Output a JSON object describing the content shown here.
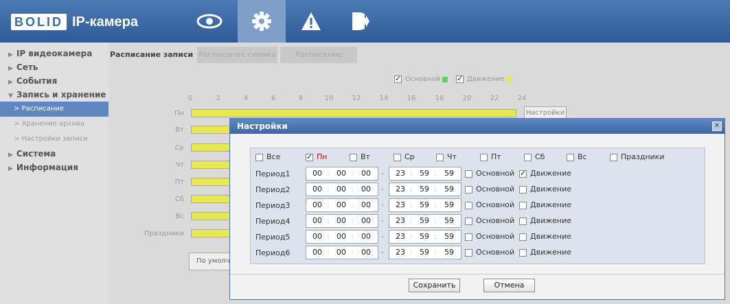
{
  "header": {
    "logo": "BOLID",
    "title": "IP-камера",
    "nav": [
      "eye-icon",
      "gear-icon",
      "alert-icon",
      "exit-icon"
    ]
  },
  "sidebar": {
    "items": [
      {
        "label": "IP видеокамера",
        "arrow": "▶"
      },
      {
        "label": "Сеть",
        "arrow": "▶"
      },
      {
        "label": "События",
        "arrow": "▶"
      },
      {
        "label": "Запись и хранение",
        "arrow": "▼"
      }
    ],
    "subitems": [
      "Расписание",
      "Хранение архива",
      "Настройки записи"
    ],
    "items2": [
      {
        "label": "Система",
        "arrow": "▶"
      },
      {
        "label": "Информация",
        "arrow": "▶"
      }
    ]
  },
  "tabs": [
    "Расписание записи",
    "Расписание снимка",
    "Расписание"
  ],
  "legend": {
    "main": "Основной",
    "motion": "Движение",
    "main_color": "#5fd35f",
    "motion_color": "#e8e84a"
  },
  "hours": [
    "0",
    "2",
    "4",
    "6",
    "8",
    "10",
    "12",
    "14",
    "16",
    "18",
    "20",
    "22",
    "24"
  ],
  "days": [
    "Пн",
    "Вт",
    "Ср",
    "Чт",
    "Пт",
    "Сб",
    "Вс",
    "Праздники"
  ],
  "settings_button": "Настройки",
  "default_button": "По умолч",
  "dialog": {
    "title": "Настройки",
    "close": "✕",
    "day_options": [
      {
        "label": "Все",
        "checked": false
      },
      {
        "label": "Пн",
        "checked": true
      },
      {
        "label": "Вт",
        "checked": false
      },
      {
        "label": "Ср",
        "checked": false
      },
      {
        "label": "Чт",
        "checked": false
      },
      {
        "label": "Пт",
        "checked": false
      },
      {
        "label": "Сб",
        "checked": false
      },
      {
        "label": "Вс",
        "checked": false
      },
      {
        "label": "Праздники",
        "checked": false
      }
    ],
    "periods": [
      {
        "label": "Период1",
        "start": [
          "00",
          "00",
          "00"
        ],
        "end": [
          "23",
          "59",
          "59"
        ],
        "main": false,
        "motion": true
      },
      {
        "label": "Период2",
        "start": [
          "00",
          "00",
          "00"
        ],
        "end": [
          "23",
          "59",
          "59"
        ],
        "main": false,
        "motion": false
      },
      {
        "label": "Период3",
        "start": [
          "00",
          "00",
          "00"
        ],
        "end": [
          "23",
          "59",
          "59"
        ],
        "main": false,
        "motion": false
      },
      {
        "label": "Период4",
        "start": [
          "00",
          "00",
          "00"
        ],
        "end": [
          "23",
          "59",
          "59"
        ],
        "main": false,
        "motion": false
      },
      {
        "label": "Период5",
        "start": [
          "00",
          "00",
          "00"
        ],
        "end": [
          "23",
          "59",
          "59"
        ],
        "main": false,
        "motion": false
      },
      {
        "label": "Период6",
        "start": [
          "00",
          "00",
          "00"
        ],
        "end": [
          "23",
          "59",
          "59"
        ],
        "main": false,
        "motion": false
      }
    ],
    "main_label": "Основной",
    "motion_label": "Движение",
    "save_label": "Сохранить",
    "cancel_label": "Отмена"
  }
}
